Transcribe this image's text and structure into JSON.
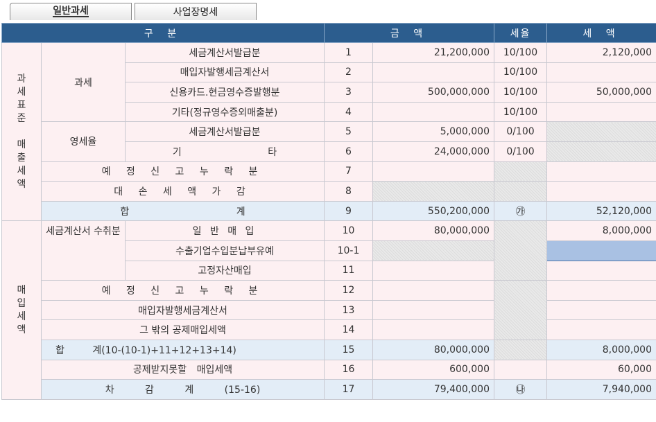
{
  "tabs": [
    "일반과세",
    "사업장명세"
  ],
  "header": {
    "gubun": "구 분",
    "amount": "금 액",
    "rate": "세율",
    "tax": "세 액"
  },
  "groups": {
    "sales": "과세표준 매출세액",
    "purchase": "매입세액",
    "taxable": "과세",
    "zero_rate": "영세율",
    "invoice_received": "세금계산서 수취분"
  },
  "rows": [
    {
      "label": "세금계산서발급분",
      "no": "1",
      "amount": "21,200,000",
      "rate": "10/100",
      "tax": "2,120,000"
    },
    {
      "label": "매입자발행세금계산서",
      "no": "2",
      "amount": "",
      "rate": "10/100",
      "tax": ""
    },
    {
      "label": "신용카드.현금영수증발행분",
      "no": "3",
      "amount": "500,000,000",
      "rate": "10/100",
      "tax": "50,000,000"
    },
    {
      "label": "기타(정규영수증외매출분)",
      "no": "4",
      "amount": "",
      "rate": "10/100",
      "tax": ""
    },
    {
      "label": "세금계산서발급분",
      "no": "5",
      "amount": "5,000,000",
      "rate": "0/100",
      "tax": ""
    },
    {
      "label": "기 타",
      "no": "6",
      "amount": "24,000,000",
      "rate": "0/100",
      "tax": ""
    },
    {
      "label": "예 정 신 고 누 락 분",
      "no": "7",
      "amount": "",
      "rate": "",
      "tax": ""
    },
    {
      "label": "대 손 세 액 가 감",
      "no": "8",
      "amount": "",
      "rate": "",
      "tax": ""
    },
    {
      "label": "합 계",
      "no": "9",
      "amount": "550,200,000",
      "rate": "㉮",
      "tax": "52,120,000"
    },
    {
      "label": "일 반 매 입",
      "no": "10",
      "amount": "80,000,000",
      "rate": "",
      "tax": "8,000,000"
    },
    {
      "label": "수출기업수입분납부유예",
      "no": "10-1",
      "amount": "",
      "rate": "",
      "tax": ""
    },
    {
      "label": "고정자산매입",
      "no": "11",
      "amount": "",
      "rate": "",
      "tax": ""
    },
    {
      "label": "예 정 신 고 누 락 분",
      "no": "12",
      "amount": "",
      "rate": "",
      "tax": ""
    },
    {
      "label": "매입자발행세금계산서",
      "no": "13",
      "amount": "",
      "rate": "",
      "tax": ""
    },
    {
      "label": "그 밖의 공제매입세액",
      "no": "14",
      "amount": "",
      "rate": "",
      "tax": ""
    },
    {
      "label": "합 계(10-(10-1)+11+12+13+14)",
      "no": "15",
      "amount": "80,000,000",
      "rate": "",
      "tax": "8,000,000"
    },
    {
      "label": "공제받지못할 매입세액",
      "no": "16",
      "amount": "600,000",
      "rate": "",
      "tax": "60,000"
    },
    {
      "label": "차 감 계 (15-16)",
      "no": "17",
      "amount": "79,400,000",
      "rate": "㉯",
      "tax": "7,940,000"
    }
  ]
}
